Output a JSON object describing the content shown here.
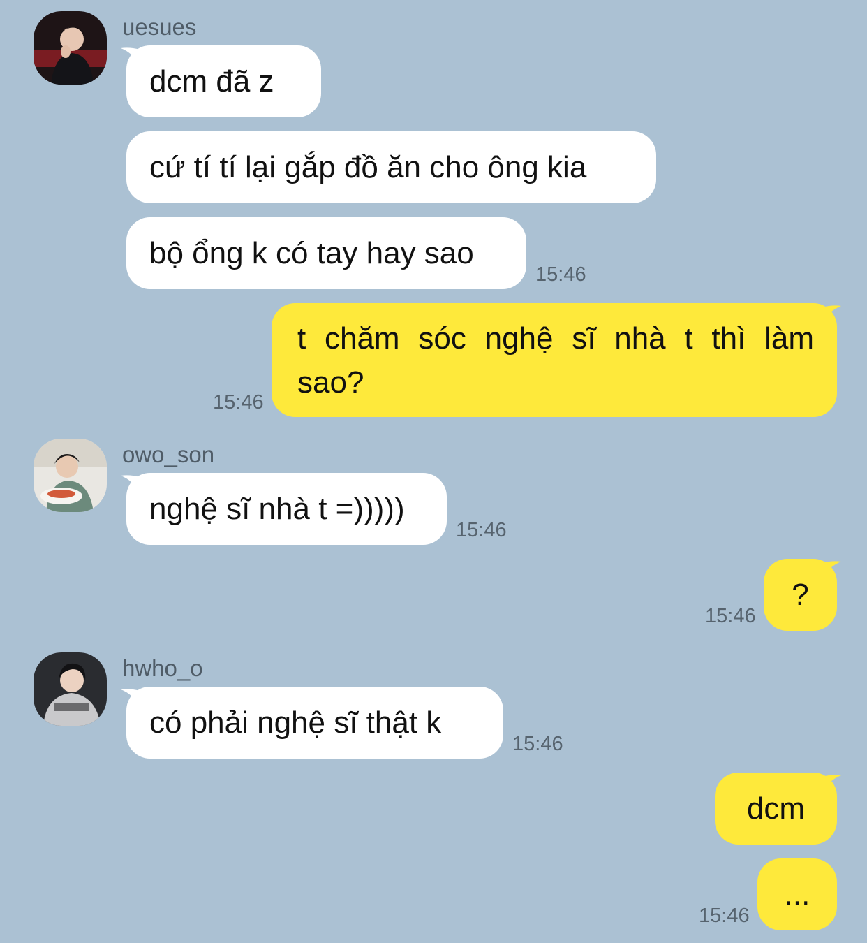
{
  "messages": {
    "m1": {
      "sender": "uesues",
      "text": "dcm đã z"
    },
    "m2": {
      "text": "cứ tí tí lại gắp đồ ăn cho ông kia"
    },
    "m3": {
      "text": "bộ ổng k có tay hay sao",
      "time": "15:46"
    },
    "m4": {
      "line1": "t chăm sóc nghệ sĩ nhà t thì làm",
      "line2": "sao?",
      "time": "15:46"
    },
    "m5": {
      "sender": "owo_son",
      "text": "nghệ sĩ nhà t =)))))",
      "time": "15:46"
    },
    "m6": {
      "text": "?",
      "time": "15:46"
    },
    "m7": {
      "sender": "hwho_o",
      "text": "có phải nghệ sĩ thật k",
      "time": "15:46"
    },
    "m8": {
      "text": "dcm"
    },
    "m9": {
      "text": "...",
      "time": "15:46"
    }
  },
  "colors": {
    "background": "#abc1d3",
    "incoming_bubble": "#ffffff",
    "outgoing_bubble": "#fee93b"
  },
  "avatars": [
    "avatar-uesues",
    "avatar-owo-son",
    "avatar-hwho-o"
  ]
}
